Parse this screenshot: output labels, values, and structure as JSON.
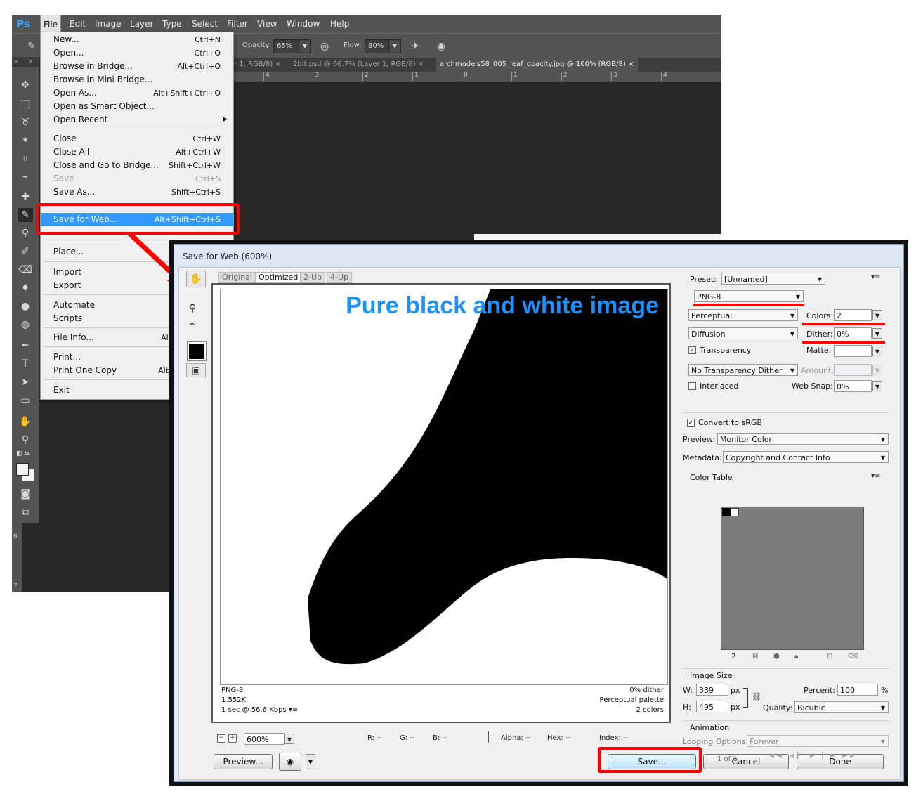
{
  "menubar": {
    "logo": "Ps",
    "items": [
      "File",
      "Edit",
      "Image",
      "Layer",
      "Type",
      "Select",
      "Filter",
      "View",
      "Window",
      "Help"
    ]
  },
  "options_bar": {
    "opacity_label": "Opacity:",
    "opacity_value": "65%",
    "flow_label": "Flow:",
    "flow_value": "80%"
  },
  "doc_tabs": [
    {
      "label": "r 1, RGB/8)",
      "active": false
    },
    {
      "label": "2bit.psd @ 66.7% (Layer 1, RGB/8)",
      "active": false
    },
    {
      "label": "archmodels58_005_leaf_opacity.jpg @ 100% (RGB/8)",
      "active": true
    }
  ],
  "ruler_top": [
    "4",
    "3",
    "2",
    "1",
    "0",
    "1",
    "2",
    "3",
    "4"
  ],
  "ruler_left": [
    "6",
    "7"
  ],
  "file_menu": {
    "items": [
      {
        "label": "New...",
        "shortcut": "Ctrl+N"
      },
      {
        "label": "Open...",
        "shortcut": "Ctrl+O"
      },
      {
        "label": "Browse in Bridge...",
        "shortcut": "Alt+Ctrl+O"
      },
      {
        "label": "Browse in Mini Bridge...",
        "shortcut": ""
      },
      {
        "label": "Open As...",
        "shortcut": "Alt+Shift+Ctrl+O"
      },
      {
        "label": "Open as Smart Object...",
        "shortcut": ""
      },
      {
        "label": "Open Recent",
        "shortcut": ""
      },
      {
        "label": "Close",
        "shortcut": "Ctrl+W"
      },
      {
        "label": "Close All",
        "shortcut": "Alt+Ctrl+W"
      },
      {
        "label": "Close and Go to Bridge...",
        "shortcut": "Shift+Ctrl+W"
      },
      {
        "label": "Save",
        "shortcut": "Ctrl+S"
      },
      {
        "label": "Save As...",
        "shortcut": "Shift+Ctrl+S"
      },
      {
        "label": "Save for Web...",
        "shortcut": "Alt+Shift+Ctrl+S"
      },
      {
        "label": "Place...",
        "shortcut": ""
      },
      {
        "label": "Import",
        "shortcut": ""
      },
      {
        "label": "Export",
        "shortcut": ""
      },
      {
        "label": "Automate",
        "shortcut": ""
      },
      {
        "label": "Scripts",
        "shortcut": ""
      },
      {
        "label": "File Info...",
        "shortcut": "Alt"
      },
      {
        "label": "Print...",
        "shortcut": ""
      },
      {
        "label": "Print One Copy",
        "shortcut": "Alt-"
      },
      {
        "label": "Exit",
        "shortcut": ""
      }
    ]
  },
  "save_for_web": {
    "title": "Save for Web (600%)",
    "view_tabs": [
      "Original",
      "Optimized",
      "2-Up",
      "4-Up"
    ],
    "annotation": "Pure black and white image",
    "info_left": [
      "PNG-8",
      "1.552K",
      "1 sec @ 56.6 Kbps"
    ],
    "info_right": [
      "0% dither",
      "Perceptual palette",
      "2 colors"
    ],
    "zoom": "600%",
    "readouts": {
      "r": "R: --",
      "g": "G: --",
      "b": "B: --",
      "alpha": "Alpha: --",
      "hex": "Hex: --",
      "index": "Index: --"
    },
    "buttons": {
      "preview": "Preview...",
      "save": "Save...",
      "cancel": "Cancel",
      "done": "Done"
    },
    "settings": {
      "preset_label": "Preset:",
      "preset_value": "[Unnamed]",
      "format": "PNG-8",
      "reduction": "Perceptual",
      "colors_label": "Colors:",
      "colors_value": "2",
      "dither_algo": "Diffusion",
      "dither_label": "Dither:",
      "dither_value": "0%",
      "transparency_label": "Transparency",
      "matte_label": "Matte:",
      "transparency_dither": "No Transparency Dither",
      "amount_label": "Amount:",
      "interlaced_label": "Interlaced",
      "websnap_label": "Web Snap:",
      "websnap_value": "0%",
      "convert_srgb_label": "Convert to sRGB",
      "preview_label": "Preview:",
      "preview_value": "Monitor Color",
      "metadata_label": "Metadata:",
      "metadata_value": "Copyright and Contact Info"
    },
    "color_table": {
      "title": "Color Table",
      "count": "2",
      "colors": [
        "#000000",
        "#ffffff"
      ]
    },
    "image_size": {
      "title": "Image Size",
      "w_label": "W:",
      "w_value": "339",
      "h_label": "H:",
      "h_value": "495",
      "unit": "px",
      "percent_label": "Percent:",
      "percent_value": "100",
      "percent_unit": "%",
      "quality_label": "Quality:",
      "quality_value": "Bicubic"
    },
    "animation": {
      "title": "Animation",
      "looping_label": "Looping Options:",
      "looping_value": "Forever",
      "frame": "1 of 1"
    }
  }
}
